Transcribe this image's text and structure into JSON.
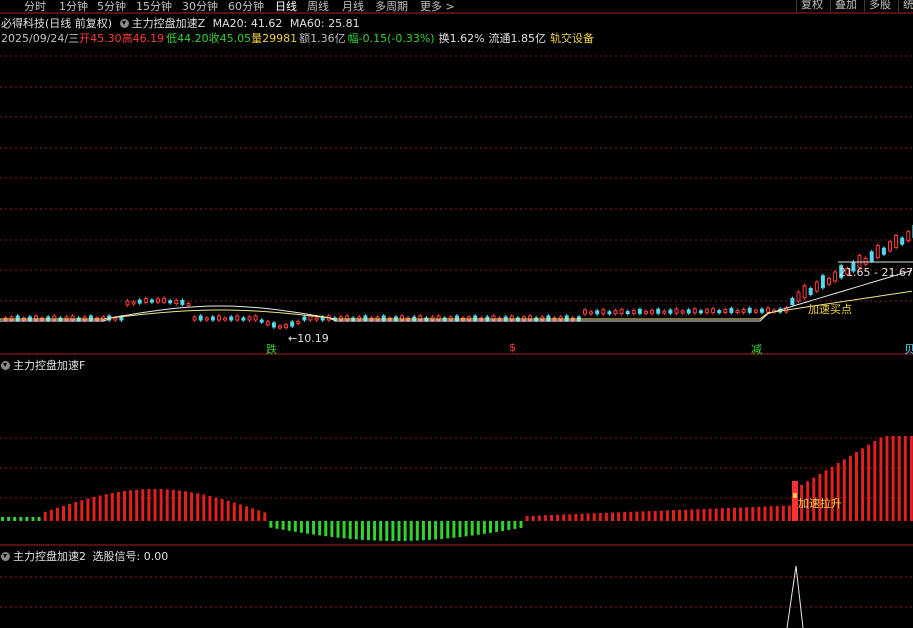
{
  "tabs": {
    "fenshi": "分时",
    "min1": "1分钟",
    "min5": "5分钟",
    "min15": "15分钟",
    "min30": "30分钟",
    "min60": "60分钟",
    "day": "日线",
    "week": "周线",
    "month": "月线",
    "multi": "多周期",
    "more": "更多 >"
  },
  "right_buttons": {
    "fuquan": "复权",
    "diejia": "叠加",
    "duogu": "多股",
    "extra": "统"
  },
  "header": {
    "title": "必得科技(日线 前复权)",
    "indicator": "主力控盘加速Z",
    "ma20": "MA20: 41.62",
    "ma60": "MA60: 25.81"
  },
  "quote": {
    "date": "2025/09/24/三",
    "open_label": "开",
    "open": "45.30",
    "high_label": "高",
    "high": "46.19",
    "low_label": "低",
    "low": "44.20",
    "close_label": "收",
    "close": "45.05",
    "vol_label": "量",
    "vol": "29981",
    "amount_label": "额",
    "amount": "1.36亿",
    "change_label": "幅",
    "change": "-0.15(-0.33%)",
    "turnover_label": "换",
    "turnover": "1.62%",
    "float_label": "流通",
    "float": "1.85亿",
    "sector": "轨交设备"
  },
  "chart_labels": {
    "low_marker": "10.19",
    "range_label": "21.65 - 21.67",
    "buy_point": "加速买点",
    "sig_die": "跌",
    "sig_dollar": "$",
    "sig_jian": "减",
    "sig_edge": "贝"
  },
  "panel2": {
    "title": "主力控盘加速F",
    "boost_label": "加速拉升"
  },
  "panel3": {
    "title": "主力控盘加速2",
    "signal": "选股信号: 0.00"
  },
  "colors": {
    "up": "#ff3c3c",
    "down": "#54d8f0",
    "green": "#32d232",
    "grid": "#8b1a1a",
    "ma": "#f0e68c"
  }
}
